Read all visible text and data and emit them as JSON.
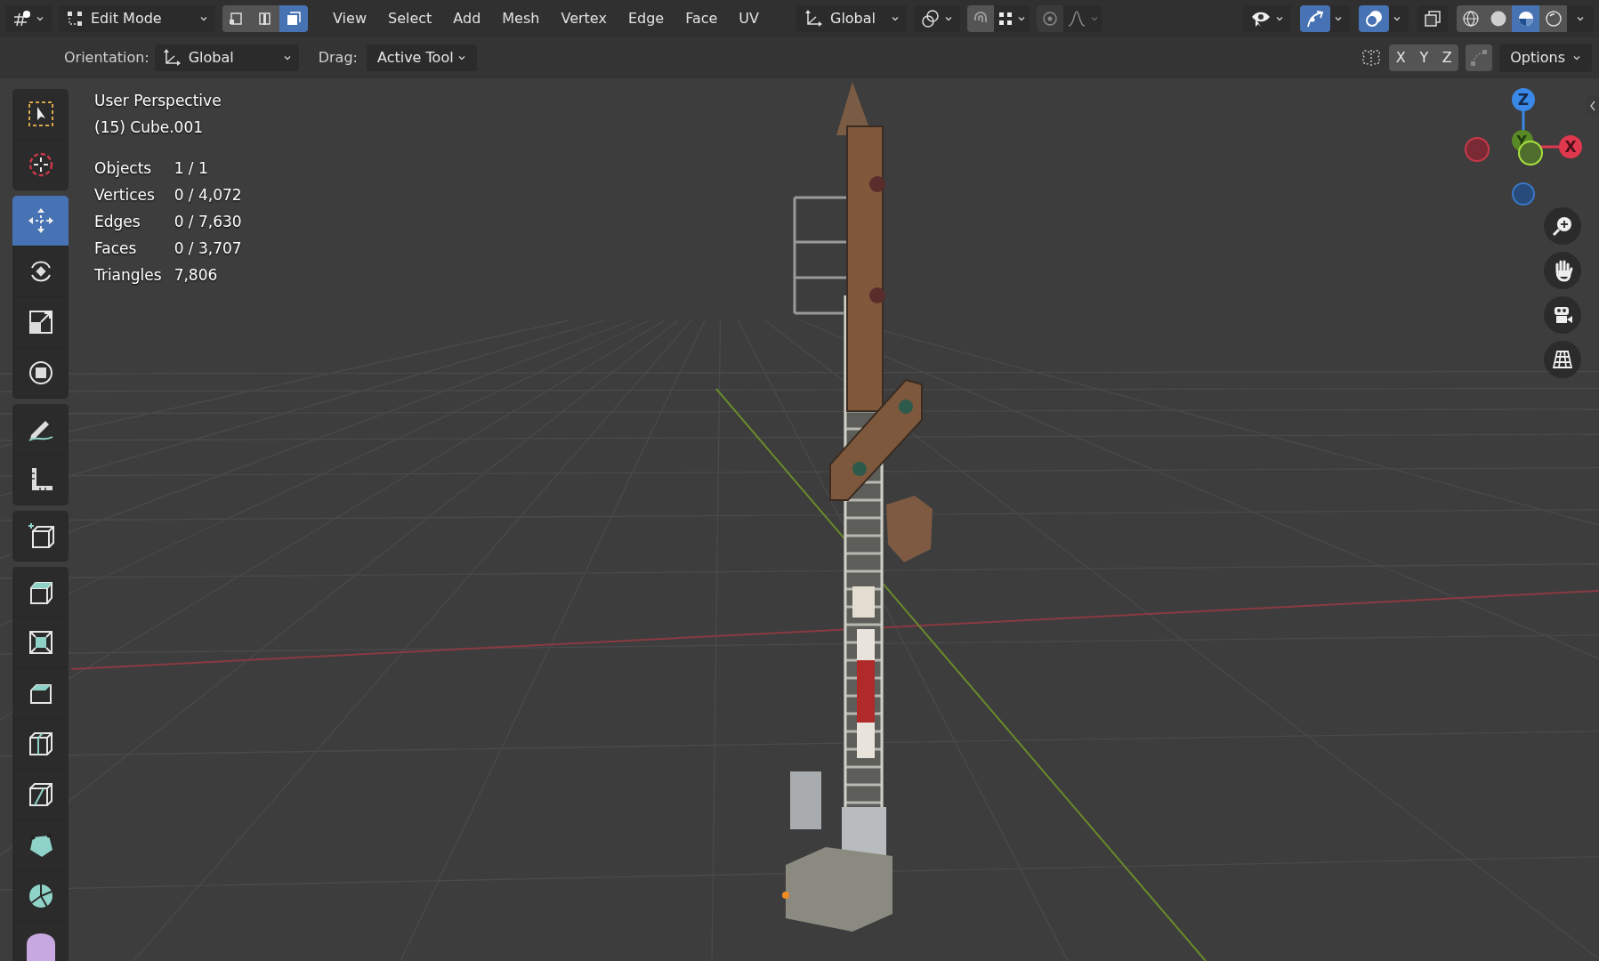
{
  "header": {
    "mode": {
      "label": "Edit Mode"
    },
    "select_modes": [
      {
        "kind": "vertex",
        "selected": false
      },
      {
        "kind": "edge",
        "selected": false
      },
      {
        "kind": "face",
        "selected": true
      }
    ],
    "menus": [
      "View",
      "Select",
      "Add",
      "Mesh",
      "Vertex",
      "Edge",
      "Face",
      "UV"
    ],
    "transform_orientation": {
      "label": "Global"
    },
    "snap": {
      "on": false
    },
    "proportional_editing": {
      "on": false
    },
    "gizmos": {
      "on": true
    },
    "overlays": {
      "on": true
    },
    "xray": {
      "on": false
    },
    "shading_modes": [
      {
        "kind": "wireframe",
        "selected": false
      },
      {
        "kind": "solid",
        "selected": false
      },
      {
        "kind": "material",
        "selected": true
      },
      {
        "kind": "rendered",
        "selected": false
      }
    ]
  },
  "tool_settings": {
    "orientation_label": "Orientation:",
    "orientation_value": "Global",
    "drag_label": "Drag:",
    "drag_value": "Active Tool",
    "axes": [
      {
        "label": "X",
        "on": false
      },
      {
        "label": "Y",
        "on": false
      },
      {
        "label": "Z",
        "on": false
      }
    ],
    "options": "Options"
  },
  "overlay_text": {
    "view": "User Perspective",
    "object": "(15) Cube.001",
    "stats": [
      {
        "label": "Objects",
        "value": "1 / 1"
      },
      {
        "label": "Vertices",
        "value": "0 / 4,072"
      },
      {
        "label": "Edges",
        "value": "0 / 7,630"
      },
      {
        "label": "Faces",
        "value": "0 / 3,707"
      },
      {
        "label": "Triangles",
        "value": "7,806"
      }
    ]
  },
  "tool_groups": [
    [
      {
        "kind": "select_box",
        "selected": false
      },
      {
        "kind": "cursor",
        "selected": false
      }
    ],
    [
      {
        "kind": "move",
        "selected": true
      },
      {
        "kind": "rotate",
        "selected": false
      },
      {
        "kind": "scale",
        "selected": false
      },
      {
        "kind": "transform",
        "selected": false
      }
    ],
    [
      {
        "kind": "annotate",
        "selected": false
      },
      {
        "kind": "measure",
        "selected": false
      }
    ],
    [
      {
        "kind": "add_cube",
        "selected": false
      }
    ],
    [
      {
        "kind": "extrude",
        "selected": false
      },
      {
        "kind": "inset",
        "selected": false
      },
      {
        "kind": "bevel",
        "selected": false
      },
      {
        "kind": "loop_cut",
        "selected": false
      },
      {
        "kind": "knife",
        "selected": false
      },
      {
        "kind": "poly_build",
        "selected": false
      },
      {
        "kind": "spin",
        "selected": false
      },
      {
        "kind": "smooth",
        "selected": false
      }
    ]
  ],
  "navigation_gizmo": {
    "axes": [
      {
        "label": "Z"
      },
      {
        "label": "Y"
      },
      {
        "label": "X"
      }
    ]
  }
}
